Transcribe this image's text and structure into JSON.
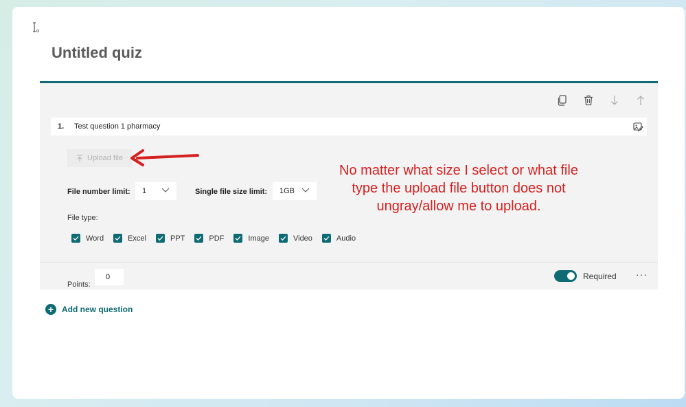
{
  "quiz": {
    "title": "Untitled quiz"
  },
  "question": {
    "number": "1.",
    "text": "Test question 1 pharmacy",
    "upload_button_label": "Upload file",
    "file_number_limit_label": "File number limit:",
    "file_number_limit_value": "1",
    "single_file_size_label": "Single file size limit:",
    "single_file_size_value": "1GB",
    "file_type_label": "File type:",
    "file_types": [
      {
        "label": "Word",
        "checked": true
      },
      {
        "label": "Excel",
        "checked": true
      },
      {
        "label": "PPT",
        "checked": true
      },
      {
        "label": "PDF",
        "checked": true
      },
      {
        "label": "Image",
        "checked": true
      },
      {
        "label": "Video",
        "checked": true
      },
      {
        "label": "Audio",
        "checked": true
      }
    ],
    "points_label": "Points:",
    "points_value": "0",
    "required_label": "Required",
    "required_on": true,
    "more_label": "···"
  },
  "toolbar": {
    "icons": [
      "copy-icon",
      "delete-icon",
      "move-down-icon",
      "move-up-icon"
    ]
  },
  "add_question_label": "Add new question",
  "annotation": {
    "text": "No matter what size I select or what file type the upload file button does not ungray/allow me to upload."
  },
  "colors": {
    "accent": "#0f6b73",
    "annotation": "#d62020",
    "card_bg": "#f3f3f3"
  }
}
